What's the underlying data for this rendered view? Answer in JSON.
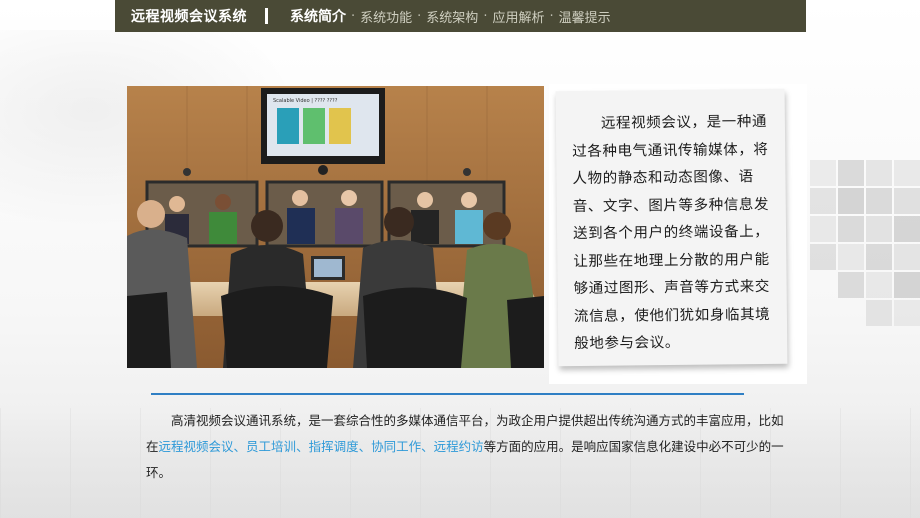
{
  "header": {
    "brand": "远程视频会议系统",
    "nav": [
      {
        "label": "系统简介",
        "active": true
      },
      {
        "label": "系统功能",
        "active": false
      },
      {
        "label": "系统架构",
        "active": false
      },
      {
        "label": "应用解析",
        "active": false
      },
      {
        "label": "温馨提示",
        "active": false
      }
    ],
    "separator": "·"
  },
  "screen_slide_title": "Scalable Video | ???? ????",
  "note": {
    "text": "远程视频会议，是一种通过各种电气通讯传输媒体，将人物的静态和动态图像、语音、文字、图片等多种信息发送到各个用户的终端设备上，让那些在地理上分散的用户能够通过图形、声音等方式来交流信息，使他们犹如身临其境般地参与会议。"
  },
  "body": {
    "intro": "高清视频会议通讯系统，是一套综合性的多媒体通信平台，为政企用户提供超出传统沟通方式的丰富应用，比如在",
    "highlights": [
      "远程视频会议",
      "员工培训",
      "指挥调度",
      "协同工作",
      "远程约访"
    ],
    "delimiter": "、",
    "outro": "等方面的应用。是响应国家信息化建设中必不可少的一环。"
  },
  "colors": {
    "header_bg": "#4a4a36",
    "accent_blue": "#2f7fc4",
    "highlight": "#2f9ad8"
  }
}
